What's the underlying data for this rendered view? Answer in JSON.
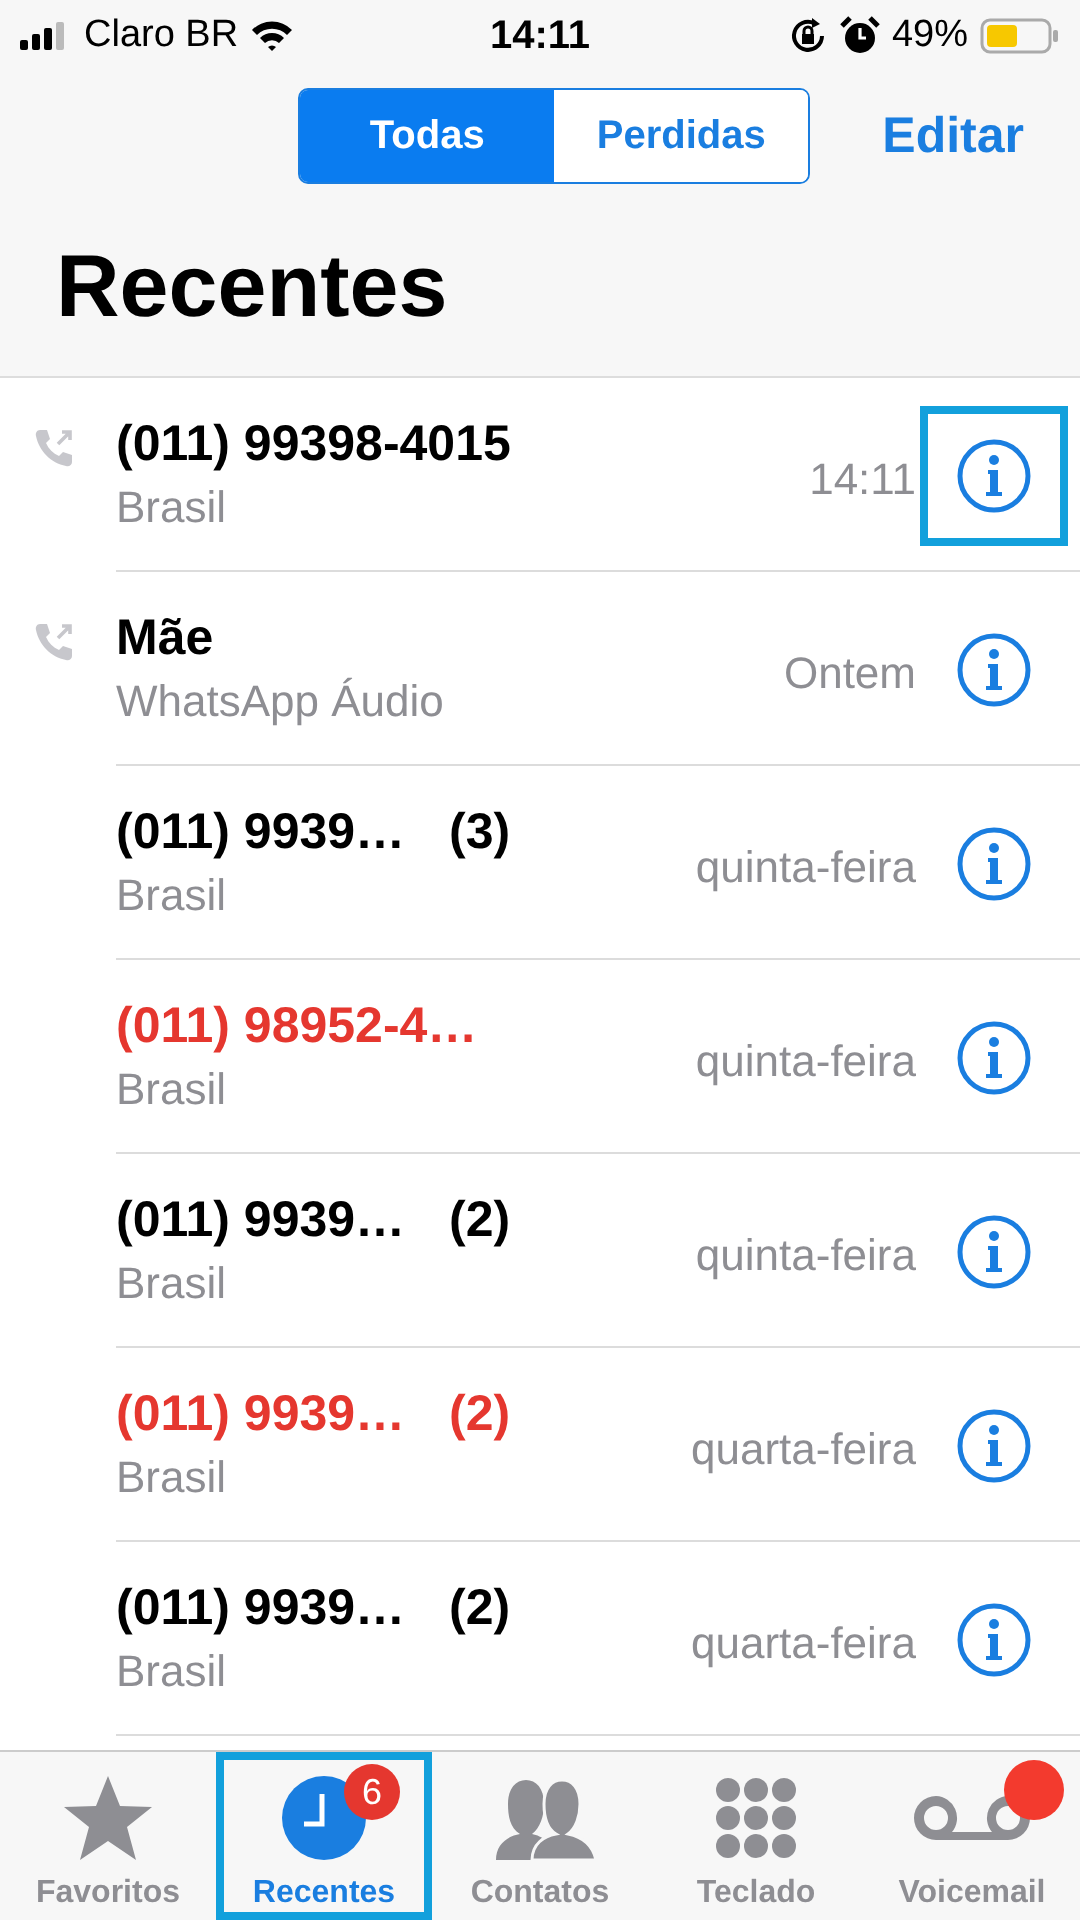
{
  "status_bar": {
    "carrier": "Claro BR",
    "time": "14:11",
    "battery": "49%"
  },
  "segments": [
    {
      "label": "Todas",
      "selected": true
    },
    {
      "label": "Perdidas",
      "selected": false
    }
  ],
  "edit_button": "Editar",
  "title": "Recentes",
  "calls": [
    {
      "kind": "outgoing",
      "name": "(011) 99398-4015",
      "missed": false,
      "subtitle": "Brasil",
      "date": "14:11",
      "highlighted": true
    },
    {
      "kind": "outgoing",
      "name": "Mãe",
      "missed": false,
      "subtitle": "WhatsApp Áudio",
      "date": "Ontem",
      "highlighted": false
    },
    {
      "kind": "plain",
      "name": "(011) 9939…",
      "count": "(3)",
      "missed": false,
      "subtitle": "Brasil",
      "date": "quinta-feira",
      "highlighted": false
    },
    {
      "kind": "plain",
      "name": "(011) 98952-4…",
      "missed": true,
      "subtitle": "Brasil",
      "date": "quinta-feira",
      "highlighted": false
    },
    {
      "kind": "plain",
      "name": "(011) 9939…",
      "count": "(2)",
      "missed": false,
      "subtitle": "Brasil",
      "date": "quinta-feira",
      "highlighted": false
    },
    {
      "kind": "plain",
      "name": "(011) 9939…",
      "count": "(2)",
      "missed": true,
      "subtitle": "Brasil",
      "date": "quarta-feira",
      "highlighted": false
    },
    {
      "kind": "plain",
      "name": "(011) 9939…",
      "count": "(2)",
      "missed": false,
      "subtitle": "Brasil",
      "date": "quarta-feira",
      "highlighted": false
    }
  ],
  "tab_bar": [
    {
      "kind": "star",
      "label": "Favoritos",
      "selected": false,
      "highlighted": false
    },
    {
      "kind": "clock",
      "label": "Recentes",
      "selected": true,
      "badge": "6",
      "highlighted": true
    },
    {
      "kind": "people",
      "label": "Contatos",
      "selected": false,
      "highlighted": false
    },
    {
      "kind": "keypad",
      "label": "Teclado",
      "selected": false,
      "highlighted": false
    },
    {
      "kind": "voicemail",
      "label": "Voicemail",
      "selected": false,
      "dot": true,
      "highlighted": false
    }
  ]
}
